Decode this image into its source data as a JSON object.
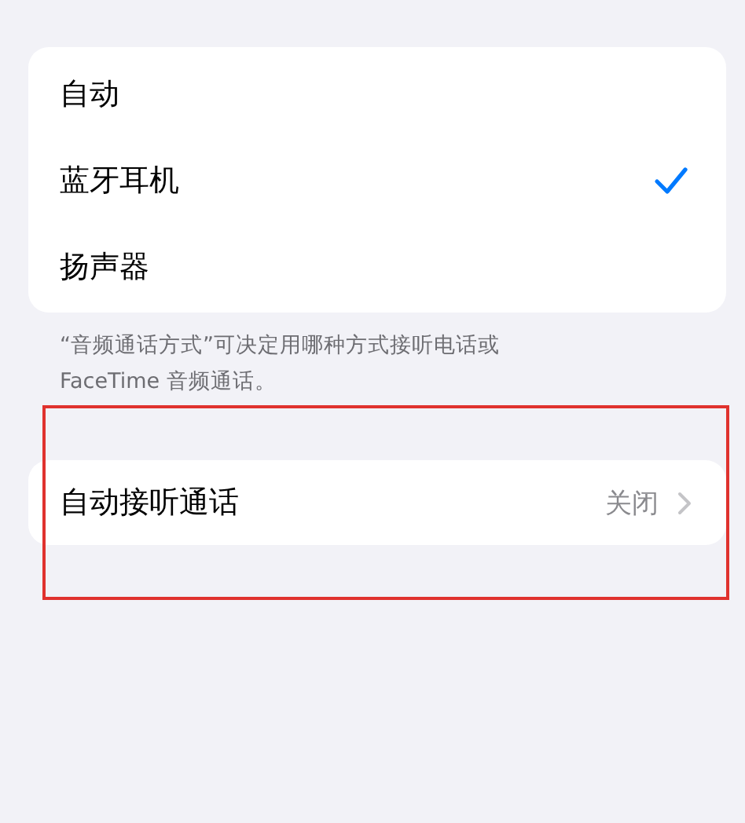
{
  "audio_routes": {
    "options": [
      {
        "label": "自动",
        "selected": false
      },
      {
        "label": "蓝牙耳机",
        "selected": true
      },
      {
        "label": "扬声器",
        "selected": false
      }
    ],
    "footer": "“音频通话方式”可决定用哪种方式接听电话或\nFaceTime 音频通话。"
  },
  "auto_answer": {
    "label": "自动接听通话",
    "value": "关闭"
  }
}
